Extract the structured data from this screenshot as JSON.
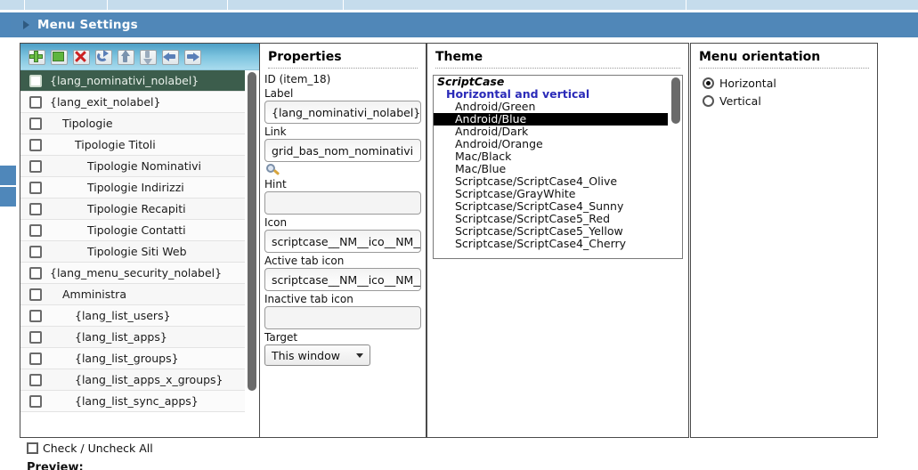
{
  "header": {
    "title": "Menu Settings",
    "expander_icon": "triangle-right-icon"
  },
  "toolbar": {
    "buttons": [
      {
        "name": "add-item-button",
        "icon": "plus-icon",
        "label": "Add"
      },
      {
        "name": "duplicate-item-button",
        "icon": "copy-icon",
        "label": "Duplicate"
      },
      {
        "name": "delete-item-button",
        "icon": "delete-x-icon",
        "label": "Delete"
      },
      {
        "name": "refresh-button",
        "icon": "refresh-arrow-icon",
        "label": "Refresh"
      },
      {
        "name": "move-up-button",
        "icon": "arrow-up-icon",
        "label": "Move up"
      },
      {
        "name": "move-down-button",
        "icon": "arrow-down-icon",
        "label": "Move down"
      },
      {
        "name": "outdent-button",
        "icon": "arrow-left-icon",
        "label": "Outdent"
      },
      {
        "name": "indent-button",
        "icon": "arrow-right-icon",
        "label": "Indent"
      }
    ]
  },
  "tree": {
    "items": [
      {
        "label": "{lang_nominativi_nolabel}",
        "indent": 0,
        "selected": true,
        "checked": false
      },
      {
        "label": "{lang_exit_nolabel}",
        "indent": 0,
        "selected": false,
        "checked": false
      },
      {
        "label": "Tipologie",
        "indent": 1,
        "selected": false,
        "checked": false
      },
      {
        "label": "Tipologie Titoli",
        "indent": 2,
        "selected": false,
        "checked": false
      },
      {
        "label": "Tipologie Nominativi",
        "indent": 3,
        "selected": false,
        "checked": false
      },
      {
        "label": "Tipologie Indirizzi",
        "indent": 3,
        "selected": false,
        "checked": false
      },
      {
        "label": "Tipologie Recapiti",
        "indent": 3,
        "selected": false,
        "checked": false
      },
      {
        "label": "Tipologie Contatti",
        "indent": 3,
        "selected": false,
        "checked": false
      },
      {
        "label": "Tipologie Siti Web",
        "indent": 3,
        "selected": false,
        "checked": false
      },
      {
        "label": "{lang_menu_security_nolabel}",
        "indent": 0,
        "selected": false,
        "checked": false
      },
      {
        "label": "Amministra",
        "indent": 1,
        "selected": false,
        "checked": false
      },
      {
        "label": "{lang_list_users}",
        "indent": 2,
        "selected": false,
        "checked": false
      },
      {
        "label": "{lang_list_apps}",
        "indent": 2,
        "selected": false,
        "checked": false
      },
      {
        "label": "{lang_list_groups}",
        "indent": 2,
        "selected": false,
        "checked": false
      },
      {
        "label": "{lang_list_apps_x_groups}",
        "indent": 2,
        "selected": false,
        "checked": false
      },
      {
        "label": "{lang_list_sync_apps}",
        "indent": 2,
        "selected": false,
        "checked": false
      }
    ]
  },
  "properties": {
    "title": "Properties",
    "id_text": "ID (item_18)",
    "label_field": {
      "label": "Label",
      "value": "{lang_nominativi_nolabel}"
    },
    "link_field": {
      "label": "Link",
      "value": "grid_bas_nom_nominativi",
      "picker_icon": "magnifier-icon"
    },
    "hint_field": {
      "label": "Hint",
      "value": ""
    },
    "icon_field": {
      "label": "Icon",
      "value": "scriptcase__NM__ico__NM__bu",
      "picker_icon": "image-icon"
    },
    "active_tab_icon_field": {
      "label": "Active tab icon",
      "value": "scriptcase__NM__ico__NM__bu",
      "picker_icon": "image-icon"
    },
    "inactive_tab_icon_field": {
      "label": "Inactive tab icon",
      "value": "",
      "picker_icon": "image-icon"
    },
    "target_field": {
      "label": "Target",
      "value": "This window",
      "options": [
        "This window"
      ]
    }
  },
  "theme": {
    "title": "Theme",
    "options": [
      {
        "text": "ScriptCase",
        "level": "grp1",
        "selected": false
      },
      {
        "text": "Horizontal and vertical",
        "level": "grp2",
        "selected": false
      },
      {
        "text": "Android/Green",
        "level": "item",
        "selected": false
      },
      {
        "text": "Android/Blue",
        "level": "item",
        "selected": true
      },
      {
        "text": "Android/Dark",
        "level": "item",
        "selected": false
      },
      {
        "text": "Android/Orange",
        "level": "item",
        "selected": false
      },
      {
        "text": "Mac/Black",
        "level": "item",
        "selected": false
      },
      {
        "text": "Mac/Blue",
        "level": "item",
        "selected": false
      },
      {
        "text": "Scriptcase/ScriptCase4_Olive",
        "level": "item",
        "selected": false
      },
      {
        "text": "Scriptcase/GrayWhite",
        "level": "item",
        "selected": false
      },
      {
        "text": "Scriptcase/ScriptCase4_Sunny",
        "level": "item",
        "selected": false
      },
      {
        "text": "Scriptcase/ScriptCase5_Red",
        "level": "item",
        "selected": false
      },
      {
        "text": "Scriptcase/ScriptCase5_Yellow",
        "level": "item",
        "selected": false
      },
      {
        "text": "Scriptcase/ScriptCase4_Cherry",
        "level": "item",
        "selected": false
      }
    ]
  },
  "orientation": {
    "title": "Menu orientation",
    "options": [
      {
        "label": "Horizontal",
        "checked": true
      },
      {
        "label": "Vertical",
        "checked": false
      }
    ]
  },
  "footer": {
    "check_all_label": "Check / Uncheck All",
    "check_all_checked": false,
    "preview_label": "Preview:"
  },
  "colors": {
    "header_blue": "#5087b8",
    "toolbar_blue": "#7cc3de",
    "selected_row_green": "#3c5d4c",
    "selected_option_black": "#000000",
    "group_link_blue": "#2a2ab8",
    "top_strip_blue": "#c5dcec"
  }
}
